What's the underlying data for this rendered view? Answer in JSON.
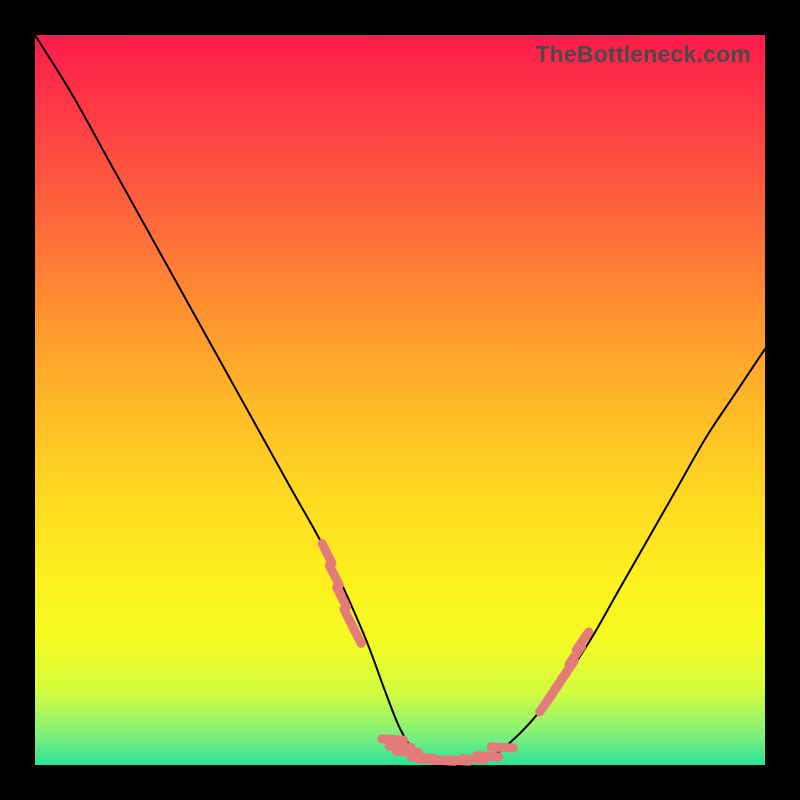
{
  "watermark": "TheBottleneck.com",
  "chart_data": {
    "type": "line",
    "title": "",
    "xlabel": "",
    "ylabel": "",
    "xlim": [
      0,
      100
    ],
    "ylim": [
      0,
      100
    ],
    "series": [
      {
        "name": "bottleneck-curve",
        "color": "#000000",
        "stroke_width": 2,
        "x": [
          0,
          5,
          10,
          15,
          20,
          25,
          30,
          35,
          40,
          45,
          48,
          50,
          52,
          55,
          58,
          60,
          63,
          65,
          68,
          72,
          76,
          80,
          84,
          88,
          92,
          96,
          100
        ],
        "y": [
          100,
          92,
          83,
          74,
          65,
          56,
          47,
          38,
          29,
          18,
          10,
          5,
          2,
          0.5,
          0.5,
          0.7,
          1.5,
          3,
          6,
          11,
          17,
          24,
          31,
          38,
          45,
          51,
          57
        ]
      },
      {
        "name": "highlight-dots-left",
        "color": "#e37b78",
        "type": "scatter",
        "marker": "dash",
        "x": [
          40,
          41,
          42,
          43,
          44
        ],
        "y": [
          29,
          26,
          23,
          20,
          18
        ]
      },
      {
        "name": "highlight-dots-valley",
        "color": "#e37b78",
        "type": "scatter",
        "marker": "dash",
        "x": [
          49,
          50,
          51,
          53,
          54,
          56,
          58,
          60,
          62,
          64
        ],
        "y": [
          3.5,
          2.5,
          1.8,
          1.0,
          0.8,
          0.6,
          0.6,
          0.8,
          1.2,
          2.4
        ]
      },
      {
        "name": "highlight-dots-right",
        "color": "#e37b78",
        "type": "scatter",
        "marker": "dash",
        "x": [
          70,
          71,
          72,
          73,
          74,
          75
        ],
        "y": [
          8.5,
          10,
          11.5,
          13,
          15,
          17
        ]
      }
    ],
    "gradient_stops": [
      {
        "pos": 0,
        "color": "#ff1a4b"
      },
      {
        "pos": 12,
        "color": "#ff3f45"
      },
      {
        "pos": 26,
        "color": "#ff6a3a"
      },
      {
        "pos": 38,
        "color": "#ff9230"
      },
      {
        "pos": 50,
        "color": "#ffb728"
      },
      {
        "pos": 62,
        "color": "#ffd621"
      },
      {
        "pos": 74,
        "color": "#fcef1e"
      },
      {
        "pos": 82,
        "color": "#f6fa1f"
      },
      {
        "pos": 90,
        "color": "#d4fb3e"
      },
      {
        "pos": 96,
        "color": "#7df07b"
      },
      {
        "pos": 100,
        "color": "#2de19a"
      }
    ]
  }
}
